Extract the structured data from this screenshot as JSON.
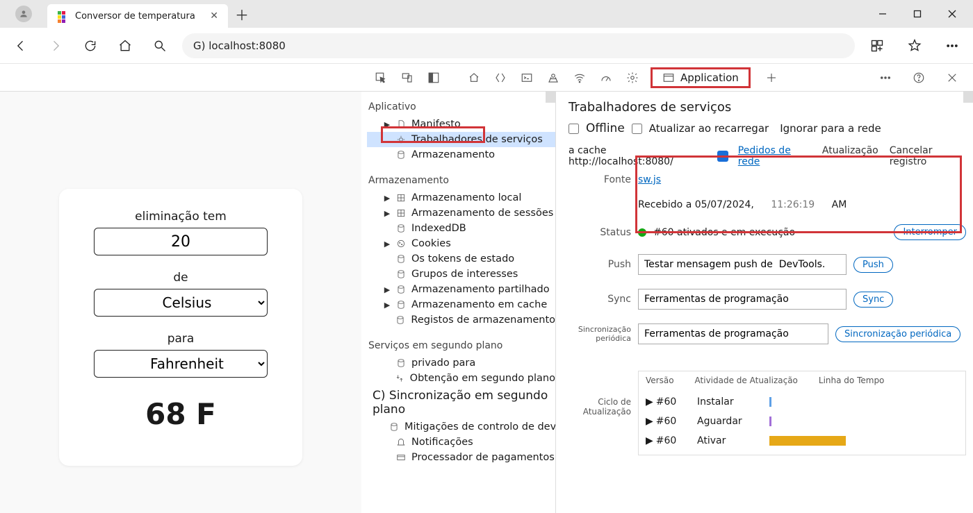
{
  "browser": {
    "tab_title": "Conversor de temperatura",
    "url": "G) localhost:8080"
  },
  "page": {
    "label_elim": "eliminação tem",
    "value": "20",
    "label_from": "de",
    "from_unit": "Celsius",
    "label_to": "para",
    "to_unit": "Fahrenheit",
    "result": "68 F"
  },
  "devtools": {
    "application_tab": "Application"
  },
  "sidebar": {
    "app_section": "Aplicativo",
    "manifest": "Manifesto",
    "service_workers": "Trabalhadores de serviços",
    "storage": "Armazenamento",
    "storage_section": "Armazenamento",
    "local_storage": "Armazenamento local",
    "session_storage": "Armazenamento de sessões",
    "indexeddb": "IndexedDB",
    "cookies": "Cookies",
    "state_tokens": "Os tokens de estado",
    "interest_groups": "Grupos de interesses",
    "shared_storage": "Armazenamento partilhado",
    "cache_storage": "Armazenamento em cache",
    "storage_logs": "Registos de armazenamento",
    "bg_section": "Serviços em segundo plano",
    "private": "privado para",
    "bg_fetch": "Obtenção em segundo plano",
    "letter_c": "C) Sincronização em segundo plano",
    "bounce": "Mitigações de controlo de devolução",
    "notifications": "Notificações",
    "payments": "Processador de pagamentos"
  },
  "sw": {
    "title": "Trabalhadores de serviços",
    "offline": "Offline",
    "update_reload": "Atualizar ao recarregar",
    "bypass": "Ignorar para a rede",
    "scope": "a cache http://localhost:8080/",
    "network_requests": "Pedidos de rede",
    "update": "Atualização",
    "unregister": "Cancelar registro",
    "source_label": "Fonte",
    "source_file": "sw.js",
    "received": "Recebido a 05/07/2024,",
    "received_time": "11:26:19",
    "received_ampm": "AM",
    "status_label": "Status",
    "status_text": "#60 ativados e em execução",
    "stop": "Interromper",
    "push_label": "Push",
    "push_value": "Testar mensagem push de  DevTools.",
    "push_btn": "Push",
    "sync_label": "Sync",
    "sync_value": "Ferramentas de programação",
    "sync_btn": "Sync",
    "psync_label": "Sincronização periódica",
    "psync_value": "Ferramentas de programação",
    "psync_btn": "Sincronização periódica",
    "cycle_label": "Ciclo de Atualização",
    "col_version": "Versão",
    "col_activity": "Atividade de Atualização",
    "col_timeline": "Linha do Tempo",
    "v60": "#60",
    "install": "Instalar",
    "wait": "Aguardar",
    "activate": "Ativar"
  }
}
